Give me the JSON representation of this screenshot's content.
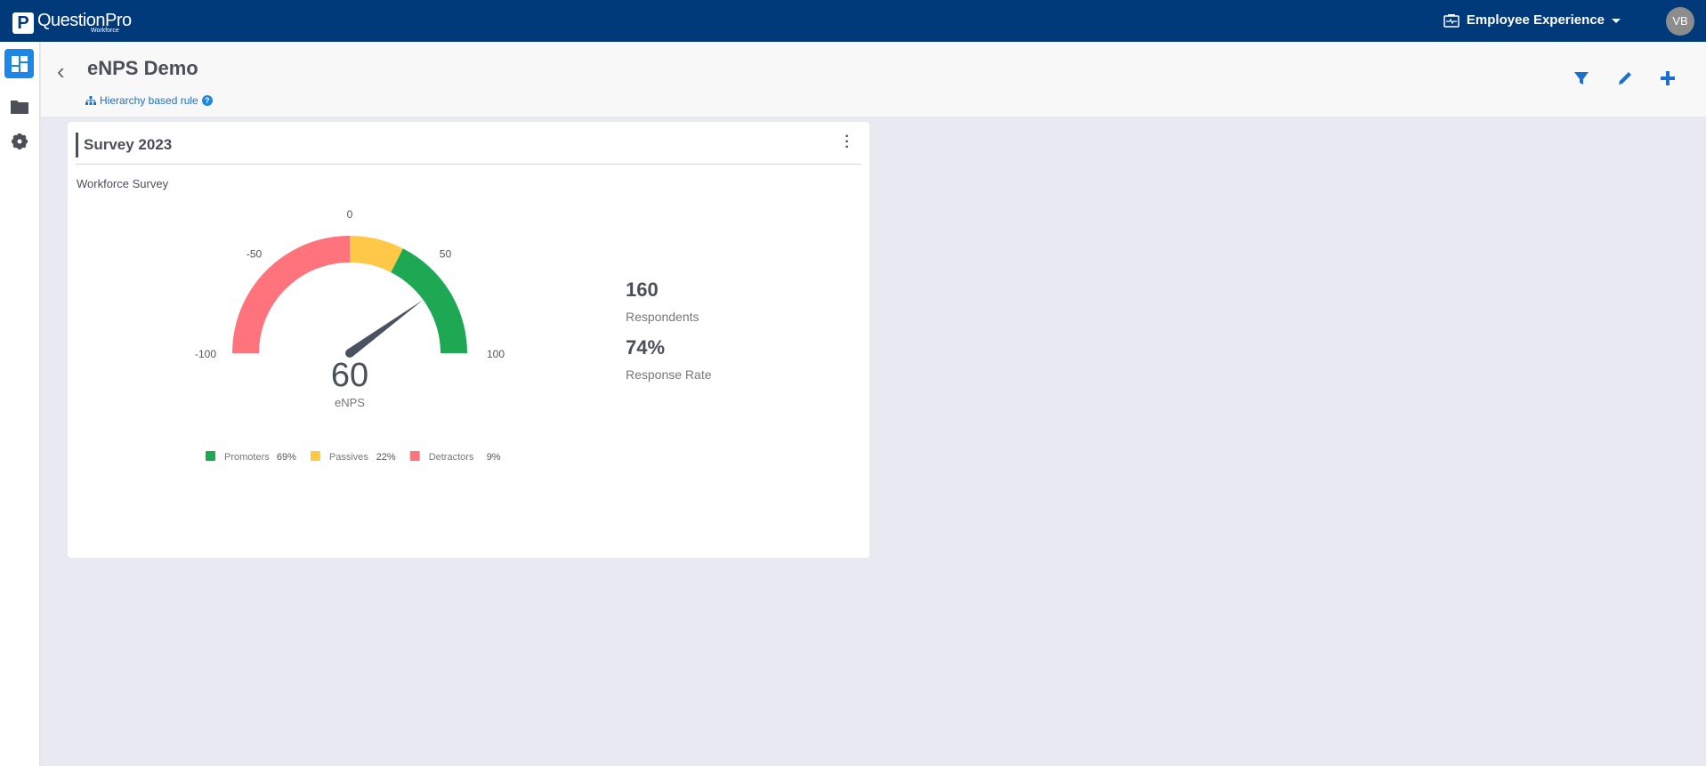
{
  "topbar": {
    "logo_letter": "P",
    "brand": "QuestionPro",
    "brand_sub": "Workforce",
    "app": "Employee Experience",
    "avatar": "VB"
  },
  "header": {
    "title": "eNPS Demo",
    "rule": "Hierarchy based rule",
    "help": "?"
  },
  "card": {
    "title": "Survey 2023",
    "subtitle": "Workforce Survey",
    "stats": [
      {
        "value": "160",
        "label": "Respondents"
      },
      {
        "value": "74%",
        "label": "Response Rate"
      }
    ]
  },
  "chart_data": {
    "type": "gauge",
    "value": 60,
    "value_label": "60",
    "caption": "eNPS",
    "min": -100,
    "max": 100,
    "ticks": [
      "-100",
      "-50",
      "0",
      "50",
      "100"
    ],
    "bands": [
      {
        "from": -100,
        "to": 0,
        "color": "#ff737d"
      },
      {
        "from": 0,
        "to": 30,
        "color": "#ffc947"
      },
      {
        "from": 30,
        "to": 100,
        "color": "#1ea853"
      }
    ],
    "legend": [
      {
        "name": "Promoters",
        "value": "69%",
        "color": "#1ea853"
      },
      {
        "name": "Passives",
        "value": "22%",
        "color": "#ffc947"
      },
      {
        "name": "Detractors",
        "value": "9%",
        "color": "#ff737d"
      }
    ]
  }
}
